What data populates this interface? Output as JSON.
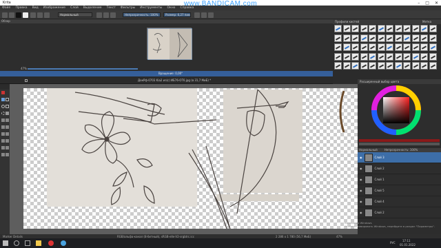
{
  "window": {
    "title": "Krita",
    "controls": [
      "–",
      "□",
      "✕"
    ]
  },
  "watermark": "www.BANDICAM.com",
  "menu": [
    "Файл",
    "Правка",
    "Вид",
    "Изображение",
    "Слой",
    "Выделение",
    "Текст",
    "Фильтры",
    "Инструменты",
    "Окно",
    "Справка"
  ],
  "toolbar": {
    "blend_mode": "Нормальный",
    "opacity": "Непрозрачность: 100%",
    "size": "Размер: 6,27 пикс."
  },
  "overview": {
    "title": "Обзор",
    "zoom": "47%",
    "rotation": "Вращение: 0,00°"
  },
  "document": {
    "tab": "ДокРф-0703 Kia2 из(с) ИБ76-ОТ6.jpg (в 31,7 МиБ) *"
  },
  "brush_presets": {
    "title": "Профили кистей",
    "tag": "Метка"
  },
  "color_selector": {
    "title": "Расширенный выбор цвета"
  },
  "layers": {
    "title": "Слои",
    "blend_mode": "Нормальный",
    "opacity": "Непрозрачность: 100%",
    "items": [
      {
        "name": "Слой 3",
        "selected": true
      },
      {
        "name": "Слой 2",
        "selected": false
      },
      {
        "name": "Слой 1",
        "selected": false
      },
      {
        "name": "Слой 5",
        "selected": false
      },
      {
        "name": "Слой 4",
        "selected": false
      },
      {
        "name": "Слой 2",
        "selected": false
      }
    ]
  },
  "status": {
    "left": "Marker Details",
    "center": "RGB/альфа-канал (8-битный), sRGB-elle-V2-srgbtrc.icc",
    "right": "2 286 x 1 780 (56,7 МиБ)",
    "zoom": "47%"
  },
  "os_watermark": {
    "line1": "Активация Windows",
    "line2": "Чтобы активировать Windows, перейдите в раздел \"Параметры\"."
  },
  "taskbar": {
    "lang": "РУС",
    "time": "17:11",
    "date": "01.01.2022"
  },
  "colors": {
    "accent": "#3d6ea8",
    "titlebar": "#ffffff",
    "panel": "#2d2d2d"
  }
}
